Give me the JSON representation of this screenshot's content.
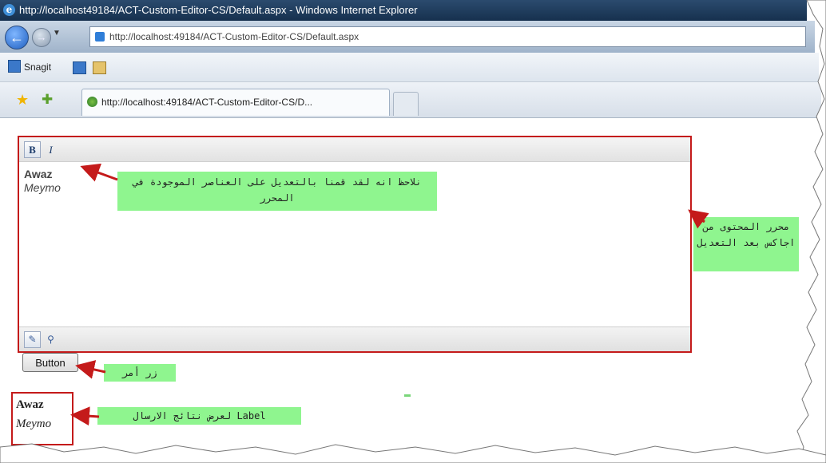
{
  "window": {
    "title": "http://localhost49184/ACT-Custom-Editor-CS/Default.aspx - Windows Internet Explorer"
  },
  "nav": {
    "address": "http://localhost:49184/ACT-Custom-Editor-CS/Default.aspx"
  },
  "toolbar": {
    "snagit_label": "Snagit"
  },
  "tabs": [
    {
      "label": "http://localhost:49184/ACT-Custom-Editor-CS/D..."
    }
  ],
  "editor": {
    "bold_label": "B",
    "italic_label": "I",
    "content": [
      "Awaz",
      "Meymo"
    ]
  },
  "page_button": {
    "label": "Button"
  },
  "label_output": {
    "lines": [
      "Awaz",
      "Meymo"
    ]
  },
  "callouts": {
    "editor_note": "نلاحظ انه لقد قمنا بالتعديل على العناصر الموجودة في المحرر",
    "editor_name": "محرر المحتوى من اجاكس بعد التعديل",
    "button_note": "زر أمر",
    "label_note": "Label لعرض نتائج الارسال"
  },
  "colors": {
    "highlight_border": "#c41a1a",
    "callout_bg": "#8ff58f"
  },
  "icons": {
    "back": "back-arrow-icon",
    "forward": "forward-arrow-icon",
    "page": "ie-page-icon",
    "favorites": "favorites-star-icon",
    "add_favorites": "add-favorites-icon",
    "tab_favicon": "tab-favicon-icon",
    "design_mode": "pencil-icon",
    "preview_mode": "magnifier-icon"
  }
}
